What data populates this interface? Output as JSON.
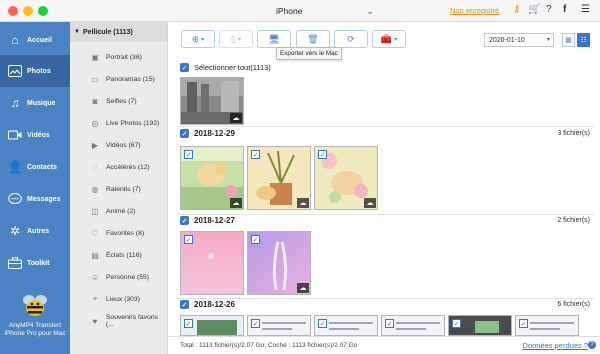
{
  "titlebar": {
    "device_name": "iPhone",
    "unregistered_label": "Non enregistré",
    "icons": [
      "key-icon",
      "cart-icon",
      "question-icon",
      "facebook-icon",
      "menu-icon"
    ]
  },
  "nav": {
    "items": [
      {
        "label": "Accueil",
        "icon": "home-icon",
        "active": false
      },
      {
        "label": "Photos",
        "icon": "photos-icon",
        "active": true
      },
      {
        "label": "Musique",
        "icon": "music-icon",
        "active": false
      },
      {
        "label": "Vidéos",
        "icon": "video-icon",
        "active": false
      },
      {
        "label": "Contacts",
        "icon": "contacts-icon",
        "active": false
      },
      {
        "label": "Messages",
        "icon": "messages-icon",
        "active": false
      },
      {
        "label": "Autres",
        "icon": "others-icon",
        "active": false
      },
      {
        "label": "Toolkit",
        "icon": "toolkit-icon",
        "active": false
      }
    ],
    "app_name_line1": "AnyMP4 Transfert",
    "app_name_line2": "iPhone Pro pour Mac"
  },
  "albums": {
    "header": "Pellicule (1113)",
    "items": [
      {
        "label": "Portrait (36)",
        "icon": "portrait-icon"
      },
      {
        "label": "Panoramas (15)",
        "icon": "panorama-icon"
      },
      {
        "label": "Selfies (7)",
        "icon": "selfie-icon"
      },
      {
        "label": "Live Photos (192)",
        "icon": "live-photo-icon"
      },
      {
        "label": "Vidéos (67)",
        "icon": "video-icon"
      },
      {
        "label": "Accélérés (12)",
        "icon": "timelapse-icon"
      },
      {
        "label": "Ralentis (7)",
        "icon": "slowmo-icon"
      },
      {
        "label": "Animé (2)",
        "icon": "animated-icon"
      },
      {
        "label": "Favorites (8)",
        "icon": "heart-icon"
      },
      {
        "label": "Éclats (116)",
        "icon": "burst-icon"
      },
      {
        "label": "Personne (55)",
        "icon": "person-icon"
      },
      {
        "label": "Lieux (303)",
        "icon": "places-icon"
      },
      {
        "label": "Souvenirs favoris (...",
        "icon": "memories-icon"
      }
    ]
  },
  "toolbar": {
    "tooltip": "Exporter vers le Mac",
    "date_value": "2020-01-10"
  },
  "main": {
    "select_all_label": "Sélectionner tout(1113)",
    "groups": [
      {
        "date": "2018-12-29",
        "count": "3 fichier(s)"
      },
      {
        "date": "2018-12-27",
        "count": "2 fichier(s)"
      },
      {
        "date": "2018-12-26",
        "count": "6 fichier(s)"
      }
    ]
  },
  "footer": {
    "total": "Total : 1113 fichier(s)/2.07 Go; Coché : 1113 fichier(s)/2.07 Go",
    "lost_data": "Données perdues ?"
  },
  "colors": {
    "nav_bg": "#4a82c3",
    "nav_active": "#3766a4",
    "accent": "#3b75c9",
    "orange": "#f08a1c"
  }
}
